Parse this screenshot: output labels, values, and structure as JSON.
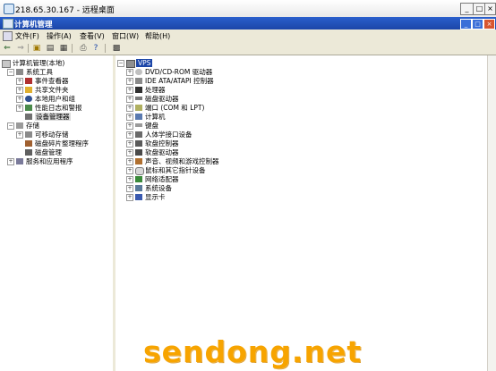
{
  "remote_window": {
    "title": "218.65.30.167 - 远程桌面"
  },
  "window": {
    "title": "计算机管理"
  },
  "menu": [
    "文件(F)",
    "操作(A)",
    "查看(V)",
    "窗口(W)",
    "帮助(H)"
  ],
  "tree": {
    "root": "计算机管理(本地)",
    "system_tools": "系统工具",
    "event_viewer": "事件查看器",
    "shared_folders": "共享文件夹",
    "local_users": "本地用户和组",
    "perf_logs": "性能日志和警报",
    "device_manager": "设备管理器",
    "storage": "存储",
    "removable": "可移动存储",
    "defrag": "磁盘碎片整理程序",
    "disk_mgmt": "磁盘管理",
    "services_apps": "服务和应用程序"
  },
  "device_root": "VPS",
  "devices": [
    "DVD/CD-ROM 驱动器",
    "IDE ATA/ATAPI 控制器",
    "处理器",
    "磁盘驱动器",
    "端口 (COM 和 LPT)",
    "计算机",
    "键盘",
    "人体学接口设备",
    "软盘控制器",
    "软盘驱动器",
    "声音、视频和游戏控制器",
    "鼠标和其它指针设备",
    "网络适配器",
    "系统设备",
    "显示卡"
  ],
  "watermark": "sendong.net"
}
